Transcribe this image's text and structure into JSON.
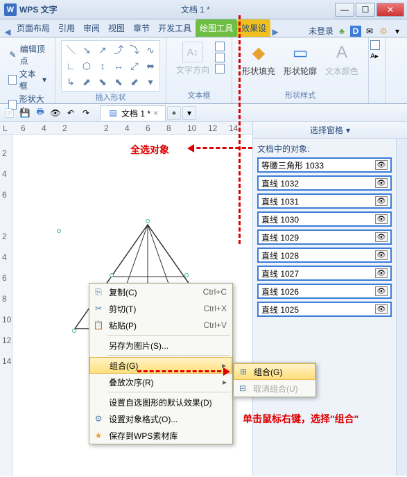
{
  "app": {
    "name": "WPS 文字",
    "doc": "文档 1 *"
  },
  "win": {
    "min": "—",
    "max": "☐",
    "close": "✕"
  },
  "tabs": {
    "items": [
      "页面布局",
      "引用",
      "审阅",
      "视图",
      "章节",
      "开发工具",
      "绘图工具",
      "效果设"
    ],
    "login": "未登录"
  },
  "ribbon": {
    "left": {
      "edit": "编辑顶点",
      "textbox": "文本框",
      "shapesize": "形状大小"
    },
    "groups": {
      "insert": "插入形状",
      "textbox": "文本框",
      "shapestyle": "形状样式"
    },
    "textdir": "文字方向",
    "fill": "形状填充",
    "outline": "形状轮廓",
    "textcolor": "文本颜色"
  },
  "doctab": "文档 1 *",
  "ruler_h": [
    "L",
    "6",
    "4",
    "2",
    "",
    "2",
    "4",
    "6",
    "8",
    "10",
    "12",
    "14"
  ],
  "ruler_v": [
    "",
    "2",
    "4",
    "6",
    "",
    "2",
    "4",
    "6",
    "8",
    "10",
    "12",
    "14"
  ],
  "annot": {
    "selectall": "全选对象",
    "rightclick": "单击鼠标右键，选择\"组合\""
  },
  "ctx": {
    "copy": {
      "l": "复制(C)",
      "s": "Ctrl+C"
    },
    "cut": {
      "l": "剪切(T)",
      "s": "Ctrl+X"
    },
    "paste": {
      "l": "粘贴(P)",
      "s": "Ctrl+V"
    },
    "saveas": "另存为图片(S)...",
    "group": "组合(G)",
    "order": "叠放次序(R)",
    "defaults": "设置自选图形的默认效果(D)",
    "format": "设置对象格式(O)...",
    "savewps": "保存到WPS素材库"
  },
  "sub": {
    "group": "组合(G)",
    "ungroup": "取消组合(U)"
  },
  "pane": {
    "title": "选择窗格",
    "label": "文档中的对象:"
  },
  "objects": [
    "等腰三角形 1033",
    "直线 1032",
    "直线 1031",
    "直线 1030",
    "直线 1029",
    "直线 1028",
    "直线 1027",
    "直线 1026",
    "直线 1025"
  ]
}
